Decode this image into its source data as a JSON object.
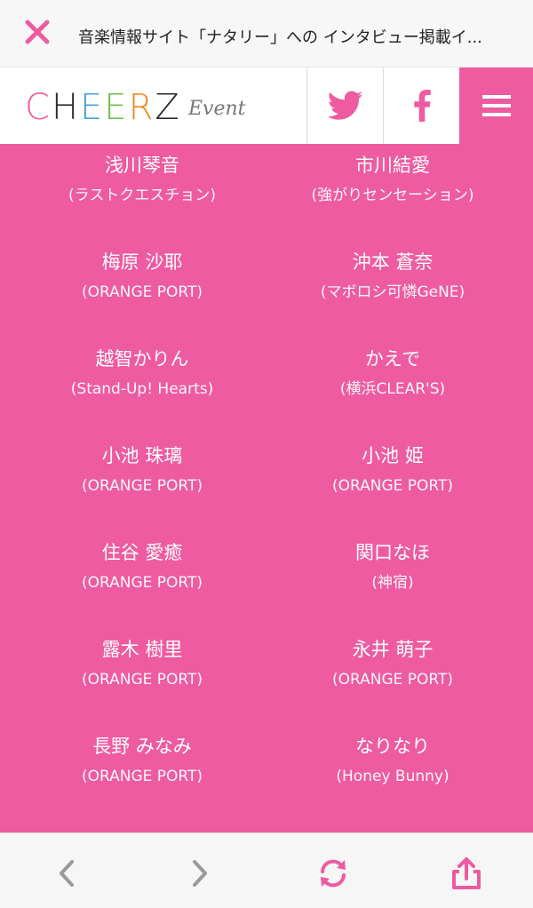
{
  "topbar": {
    "title": "音楽情報サイト「ナタリー」への インタビュー掲載イ..."
  },
  "logo": {
    "letters": [
      "C",
      "H",
      "E",
      "E",
      "R",
      "Z"
    ],
    "event": "Event",
    "colors": [
      "#ee5ba0",
      "#2c2c2c",
      "#46a2dc",
      "#6cc24a",
      "#f08a24",
      "#2c2c2c"
    ]
  },
  "colors": {
    "accent": "#ee5ba0",
    "twitter": "#ee5ba0"
  },
  "members": [
    {
      "name": "浅川琴音",
      "group": "(ラストクエスチョン)"
    },
    {
      "name": "市川結愛",
      "group": "(強がりセンセーション)"
    },
    {
      "name": "梅原 沙耶",
      "group": "(ORANGE PORT)"
    },
    {
      "name": "沖本 蒼奈",
      "group": "(マボロシ可憐GeNE)"
    },
    {
      "name": "越智かりん",
      "group": "(Stand-Up! Hearts)"
    },
    {
      "name": "かえで",
      "group": "(横浜CLEAR'S)"
    },
    {
      "name": "小池 珠璃",
      "group": "(ORANGE PORT)"
    },
    {
      "name": "小池 姫",
      "group": "(ORANGE PORT)"
    },
    {
      "name": "住谷 愛癒",
      "group": "(ORANGE PORT)"
    },
    {
      "name": "関口なほ",
      "group": "(神宿)"
    },
    {
      "name": "露木 樹里",
      "group": "(ORANGE PORT)"
    },
    {
      "name": "永井 萌子",
      "group": "(ORANGE PORT)"
    },
    {
      "name": "長野 みなみ",
      "group": "(ORANGE PORT)"
    },
    {
      "name": "なりなり",
      "group": "(Honey Bunny)"
    }
  ],
  "icons": [
    "close-icon",
    "twitter-icon",
    "facebook-icon",
    "menu-icon",
    "back-icon",
    "forward-icon",
    "refresh-icon",
    "share-icon"
  ]
}
